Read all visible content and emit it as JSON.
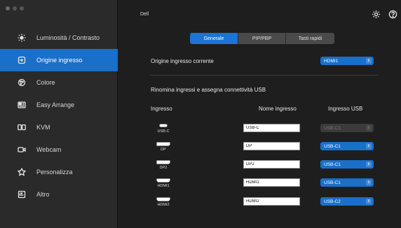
{
  "window": {
    "title": "Dell"
  },
  "sidebar": {
    "items": [
      {
        "label": "Luminosità / Contrasto",
        "icon": "brightness-icon"
      },
      {
        "label": "Origine ingresso",
        "icon": "input-source-icon",
        "active": true
      },
      {
        "label": "Colore",
        "icon": "color-icon"
      },
      {
        "label": "Easy Arrange",
        "icon": "easy-arrange-icon"
      },
      {
        "label": "KVM",
        "icon": "kvm-icon"
      },
      {
        "label": "Webcam",
        "icon": "webcam-icon"
      },
      {
        "label": "Personalizza",
        "icon": "star-icon"
      },
      {
        "label": "Altro",
        "icon": "other-icon"
      }
    ]
  },
  "header": {
    "icons": [
      "settings-gear-icon",
      "help-icon"
    ]
  },
  "tabs": [
    {
      "label": "Generale",
      "active": true
    },
    {
      "label": "PIP/PBP",
      "active": false
    },
    {
      "label": "Tasti rapidi",
      "active": false
    }
  ],
  "current_source": {
    "label": "Origine ingresso corrente",
    "value": "HDMI1"
  },
  "rename": {
    "title": "Rinomina ingressi e assegna connettività USB",
    "headers": {
      "input": "Ingresso",
      "name": "Nome ingresso",
      "usb": "Ingresso USB"
    },
    "rows": [
      {
        "port": "USB-C",
        "port_icon": "usb-c-port-icon",
        "name": "USB-C",
        "usb": "USB-C1",
        "usb_disabled": true
      },
      {
        "port": "DP",
        "port_icon": "displayport-icon",
        "name": "DP",
        "usb": "USB-C1",
        "usb_disabled": false
      },
      {
        "port": "DP2",
        "port_icon": "displayport-icon",
        "name": "DP2",
        "usb": "USB-C1",
        "usb_disabled": false
      },
      {
        "port": "HDMI1",
        "port_icon": "hdmi-port-icon",
        "name": "HDMI1",
        "usb": "USB-C1",
        "usb_disabled": false
      },
      {
        "port": "HDMI2",
        "port_icon": "hdmi-port-icon",
        "name": "HDMI2",
        "usb": "USB-C2",
        "usb_disabled": false
      }
    ]
  },
  "colors": {
    "accent": "#1a6fc9",
    "sidebar_bg": "#2a2a2a",
    "main_bg": "#1e1e1e"
  }
}
